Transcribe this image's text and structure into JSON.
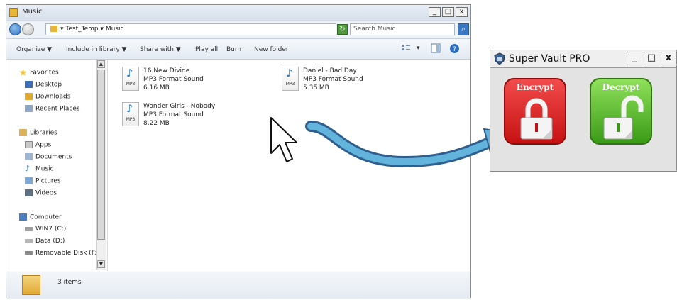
{
  "explorer": {
    "title": "Music",
    "window_controls": [
      "_",
      "□",
      "x"
    ],
    "breadcrumb": "▾ Test_Temp ▾ Music",
    "search_placeholder": "Search Music",
    "toolbar": {
      "organize": "Organize ▼",
      "include": "Include in library ▼",
      "share": "Share with ▼",
      "play_all": "Play all",
      "burn": "Burn",
      "new_folder": "New folder"
    },
    "sidebar": {
      "favorites": "Favorites",
      "desktop": "Desktop",
      "downloads": "Downloads",
      "recent": "Recent Places",
      "libraries": "Libraries",
      "apps": "Apps",
      "documents": "Documents",
      "music": "Music",
      "pictures": "Pictures",
      "videos": "Videos",
      "computer": "Computer",
      "win7": "WIN7 (C:)",
      "data": "Data (D:)",
      "removable": "Removable Disk (F:"
    },
    "files": [
      {
        "name": "16.New Divide",
        "type": "MP3 Format Sound",
        "size": "6.16 MB",
        "icon_label": "MP3"
      },
      {
        "name": "Daniel - Bad Day",
        "type": "MP3 Format Sound",
        "size": "5.35 MB",
        "icon_label": "MP3"
      },
      {
        "name": "Wonder Girls - Nobody",
        "type": "MP3 Format Sound",
        "size": "8.22 MB",
        "icon_label": "MP3"
      }
    ],
    "status": "3 items"
  },
  "vault": {
    "title": "Super Vault PRO",
    "window_controls": [
      "_",
      "□",
      "x"
    ],
    "encrypt_label": "Encrypt",
    "decrypt_label": "Decrypt"
  },
  "colors": {
    "encrypt": "#d81b1b",
    "decrypt": "#4fb321",
    "arrow": "#3f8fbf"
  }
}
